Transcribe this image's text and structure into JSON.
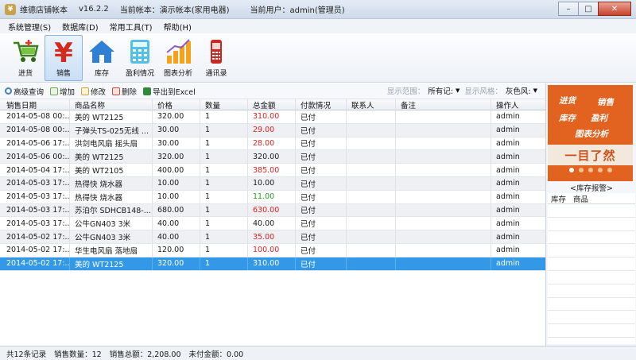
{
  "window": {
    "app_name": "维德店铺帐本",
    "version": "v16.2.2",
    "account": "当前帐本：演示帐本(家用电器)",
    "user": "当前用户：admin(管理员)"
  },
  "menu": [
    "系统管理(S)",
    "数据库(D)",
    "常用工具(T)",
    "帮助(H)"
  ],
  "toolbar": {
    "items": [
      {
        "label": "进货",
        "icon": "cart-icon"
      },
      {
        "label": "销售",
        "icon": "yen-icon"
      },
      {
        "label": "库存",
        "icon": "house-icon"
      },
      {
        "label": "盈利情况",
        "icon": "calculator-icon"
      },
      {
        "label": "图表分析",
        "icon": "bar-chart-icon"
      },
      {
        "label": "通讯录",
        "icon": "phone-icon"
      }
    ],
    "active_index": 1
  },
  "subbar": {
    "advanced_search": "高级查询",
    "add": "增加",
    "edit": "修改",
    "delete": "删除",
    "export": "导出到Excel",
    "range_label": "显示范围：",
    "range_value": "所有记:",
    "style_label": "显示风格：",
    "style_value": "灰色风:"
  },
  "table": {
    "columns": [
      "销售日期",
      "商品名称",
      "价格",
      "数量",
      "总金额",
      "付款情况",
      "联系人",
      "备注",
      "操作人"
    ],
    "rows": [
      {
        "date": "2014-05-08 00:...",
        "name": "美的 WT2125",
        "price": "320.00",
        "qty": "1",
        "total": "310.00",
        "total_color": "red",
        "pay": "已付",
        "contact": "",
        "note": "",
        "op": "admin"
      },
      {
        "date": "2014-05-08 00:...",
        "name": "子弹头TS-025无线 ...",
        "price": "30.00",
        "qty": "1",
        "total": "29.00",
        "total_color": "red",
        "pay": "已付",
        "contact": "",
        "note": "",
        "op": "admin"
      },
      {
        "date": "2014-05-06 17:...",
        "name": "洪剑电风扇 摇头扇",
        "price": "30.00",
        "qty": "1",
        "total": "28.00",
        "total_color": "red",
        "pay": "已付",
        "contact": "",
        "note": "",
        "op": "admin"
      },
      {
        "date": "2014-05-06 00:...",
        "name": "美的 WT2125",
        "price": "320.00",
        "qty": "1",
        "total": "320.00",
        "total_color": "",
        "pay": "已付",
        "contact": "",
        "note": "",
        "op": "admin"
      },
      {
        "date": "2014-05-04 17:...",
        "name": "美的 WT2105",
        "price": "400.00",
        "qty": "1",
        "total": "385.00",
        "total_color": "red",
        "pay": "已付",
        "contact": "",
        "note": "",
        "op": "admin"
      },
      {
        "date": "2014-05-03 17:...",
        "name": "热得快 烧水器",
        "price": "10.00",
        "qty": "1",
        "total": "10.00",
        "total_color": "",
        "pay": "已付",
        "contact": "",
        "note": "",
        "op": "admin"
      },
      {
        "date": "2014-05-03 17:...",
        "name": "热得快 烧水器",
        "price": "10.00",
        "qty": "1",
        "total": "11.00",
        "total_color": "green",
        "pay": "已付",
        "contact": "",
        "note": "",
        "op": "admin"
      },
      {
        "date": "2014-05-03 17:...",
        "name": "苏泊尔 SDHCB148-...",
        "price": "680.00",
        "qty": "1",
        "total": "630.00",
        "total_color": "red",
        "pay": "已付",
        "contact": "",
        "note": "",
        "op": "admin"
      },
      {
        "date": "2014-05-03 17:...",
        "name": "公牛GN403 3米",
        "price": "40.00",
        "qty": "1",
        "total": "40.00",
        "total_color": "",
        "pay": "已付",
        "contact": "",
        "note": "",
        "op": "admin"
      },
      {
        "date": "2014-05-02 17:...",
        "name": "公牛GN403 3米",
        "price": "40.00",
        "qty": "1",
        "total": "35.00",
        "total_color": "red",
        "pay": "已付",
        "contact": "",
        "note": "",
        "op": "admin"
      },
      {
        "date": "2014-05-02 17:...",
        "name": "华生电风扇 落地扇",
        "price": "120.00",
        "qty": "1",
        "total": "100.00",
        "total_color": "red",
        "pay": "已付",
        "contact": "",
        "note": "",
        "op": "admin"
      },
      {
        "date": "2014-05-02 17:...",
        "name": "美的 WT2125",
        "price": "320.00",
        "qty": "1",
        "total": "310.00",
        "total_color": "",
        "pay": "已付",
        "contact": "",
        "note": "",
        "op": "admin",
        "selected": true
      }
    ]
  },
  "side": {
    "banner_words": [
      "进货",
      "销售",
      "库存",
      "盈利",
      "图表分析"
    ],
    "banner_slogan": "一目了然",
    "stock_title": "<库存报警>",
    "stock_columns": [
      "库存",
      "商品"
    ]
  },
  "status": {
    "records": "共12条记录",
    "qty": "销售数量：12",
    "total": "销售总额：2,208.00",
    "unpaid": "未付金额：0.00"
  },
  "colors": {
    "selected_row": "#3399e6",
    "negative": "#e02020",
    "positive": "#22a022",
    "banner": "#e2621f"
  }
}
